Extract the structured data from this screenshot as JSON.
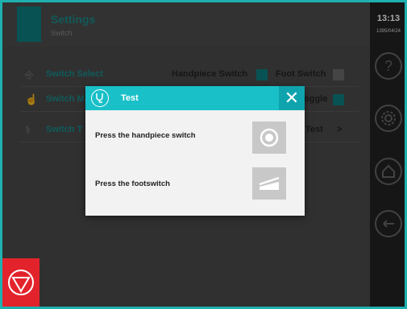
{
  "header": {
    "title": "Settings",
    "subtitle": "Switch"
  },
  "rows": [
    {
      "label": "Switch Select",
      "options": [
        "Handpiece Switch",
        "Foot Switch"
      ]
    },
    {
      "label": "Switch M",
      "trailing": "oggle"
    },
    {
      "label": "Switch T",
      "trailing": "Test",
      "chevron": ">"
    }
  ],
  "sidebar": {
    "clock": "13:13",
    "date": "1395/04/24"
  },
  "dialog": {
    "title": "Test",
    "steps": [
      {
        "label": "Press the handpiece switch"
      },
      {
        "label": "Press the footswitch"
      }
    ]
  },
  "colors": {
    "accent": "#19c0c8",
    "emergency": "#e3232b"
  },
  "icons": [
    "stethoscope-icon",
    "close-icon",
    "help-icon",
    "gear-icon",
    "home-icon",
    "back-icon",
    "emergency-stop-icon"
  ]
}
